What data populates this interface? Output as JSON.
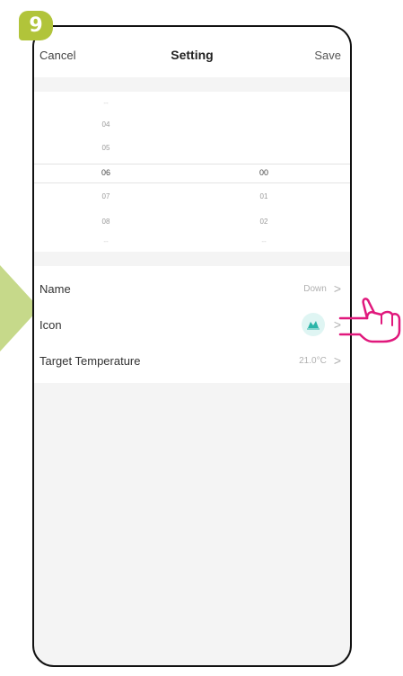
{
  "step_badge": "9",
  "header": {
    "cancel_label": "Cancel",
    "title": "Setting",
    "save_label": "Save"
  },
  "picker": {
    "hours": [
      "--",
      "04",
      "05",
      "06",
      "07",
      "08",
      "--"
    ],
    "selected_hour": "06",
    "minutes": [
      "00",
      "01",
      "02",
      "--"
    ],
    "selected_minute": "00"
  },
  "settings": {
    "name": {
      "label": "Name",
      "value": "Down"
    },
    "icon": {
      "label": "Icon",
      "icon_name": "sunrise-icon"
    },
    "target_temperature": {
      "label": "Target Temperature",
      "value": "21.0°C"
    }
  },
  "colors": {
    "badge": "#b1c43a",
    "arrow": "#c6d98a",
    "accent": "#e0187c",
    "icon_bg": "#dff5f3",
    "icon_fg": "#2bb5a8"
  }
}
